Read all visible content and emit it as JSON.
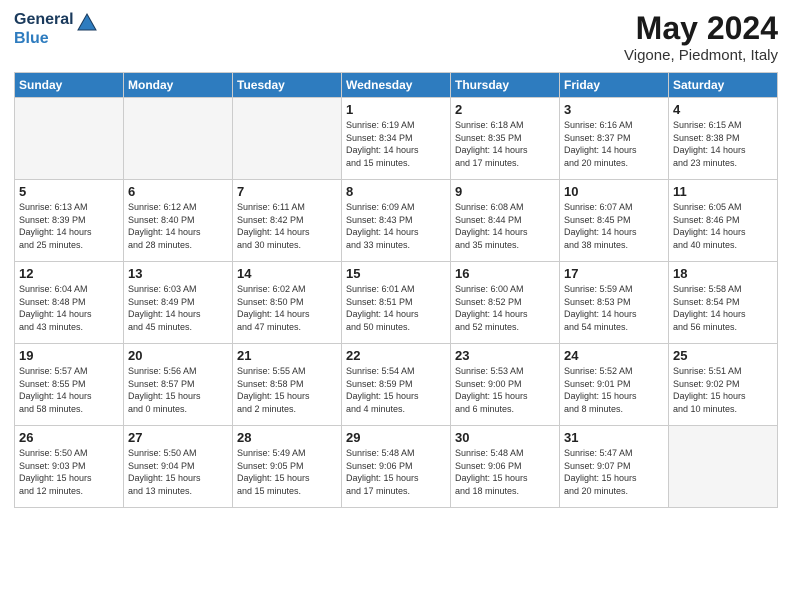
{
  "header": {
    "logo_line1": "General",
    "logo_line2": "Blue",
    "month": "May 2024",
    "location": "Vigone, Piedmont, Italy"
  },
  "weekdays": [
    "Sunday",
    "Monday",
    "Tuesday",
    "Wednesday",
    "Thursday",
    "Friday",
    "Saturday"
  ],
  "weeks": [
    [
      {
        "day": "",
        "info": "",
        "empty": true
      },
      {
        "day": "",
        "info": "",
        "empty": true
      },
      {
        "day": "",
        "info": "",
        "empty": true
      },
      {
        "day": "1",
        "info": "Sunrise: 6:19 AM\nSunset: 8:34 PM\nDaylight: 14 hours\nand 15 minutes."
      },
      {
        "day": "2",
        "info": "Sunrise: 6:18 AM\nSunset: 8:35 PM\nDaylight: 14 hours\nand 17 minutes."
      },
      {
        "day": "3",
        "info": "Sunrise: 6:16 AM\nSunset: 8:37 PM\nDaylight: 14 hours\nand 20 minutes."
      },
      {
        "day": "4",
        "info": "Sunrise: 6:15 AM\nSunset: 8:38 PM\nDaylight: 14 hours\nand 23 minutes."
      }
    ],
    [
      {
        "day": "5",
        "info": "Sunrise: 6:13 AM\nSunset: 8:39 PM\nDaylight: 14 hours\nand 25 minutes."
      },
      {
        "day": "6",
        "info": "Sunrise: 6:12 AM\nSunset: 8:40 PM\nDaylight: 14 hours\nand 28 minutes."
      },
      {
        "day": "7",
        "info": "Sunrise: 6:11 AM\nSunset: 8:42 PM\nDaylight: 14 hours\nand 30 minutes."
      },
      {
        "day": "8",
        "info": "Sunrise: 6:09 AM\nSunset: 8:43 PM\nDaylight: 14 hours\nand 33 minutes."
      },
      {
        "day": "9",
        "info": "Sunrise: 6:08 AM\nSunset: 8:44 PM\nDaylight: 14 hours\nand 35 minutes."
      },
      {
        "day": "10",
        "info": "Sunrise: 6:07 AM\nSunset: 8:45 PM\nDaylight: 14 hours\nand 38 minutes."
      },
      {
        "day": "11",
        "info": "Sunrise: 6:05 AM\nSunset: 8:46 PM\nDaylight: 14 hours\nand 40 minutes."
      }
    ],
    [
      {
        "day": "12",
        "info": "Sunrise: 6:04 AM\nSunset: 8:48 PM\nDaylight: 14 hours\nand 43 minutes."
      },
      {
        "day": "13",
        "info": "Sunrise: 6:03 AM\nSunset: 8:49 PM\nDaylight: 14 hours\nand 45 minutes."
      },
      {
        "day": "14",
        "info": "Sunrise: 6:02 AM\nSunset: 8:50 PM\nDaylight: 14 hours\nand 47 minutes."
      },
      {
        "day": "15",
        "info": "Sunrise: 6:01 AM\nSunset: 8:51 PM\nDaylight: 14 hours\nand 50 minutes."
      },
      {
        "day": "16",
        "info": "Sunrise: 6:00 AM\nSunset: 8:52 PM\nDaylight: 14 hours\nand 52 minutes."
      },
      {
        "day": "17",
        "info": "Sunrise: 5:59 AM\nSunset: 8:53 PM\nDaylight: 14 hours\nand 54 minutes."
      },
      {
        "day": "18",
        "info": "Sunrise: 5:58 AM\nSunset: 8:54 PM\nDaylight: 14 hours\nand 56 minutes."
      }
    ],
    [
      {
        "day": "19",
        "info": "Sunrise: 5:57 AM\nSunset: 8:55 PM\nDaylight: 14 hours\nand 58 minutes."
      },
      {
        "day": "20",
        "info": "Sunrise: 5:56 AM\nSunset: 8:57 PM\nDaylight: 15 hours\nand 0 minutes."
      },
      {
        "day": "21",
        "info": "Sunrise: 5:55 AM\nSunset: 8:58 PM\nDaylight: 15 hours\nand 2 minutes."
      },
      {
        "day": "22",
        "info": "Sunrise: 5:54 AM\nSunset: 8:59 PM\nDaylight: 15 hours\nand 4 minutes."
      },
      {
        "day": "23",
        "info": "Sunrise: 5:53 AM\nSunset: 9:00 PM\nDaylight: 15 hours\nand 6 minutes."
      },
      {
        "day": "24",
        "info": "Sunrise: 5:52 AM\nSunset: 9:01 PM\nDaylight: 15 hours\nand 8 minutes."
      },
      {
        "day": "25",
        "info": "Sunrise: 5:51 AM\nSunset: 9:02 PM\nDaylight: 15 hours\nand 10 minutes."
      }
    ],
    [
      {
        "day": "26",
        "info": "Sunrise: 5:50 AM\nSunset: 9:03 PM\nDaylight: 15 hours\nand 12 minutes."
      },
      {
        "day": "27",
        "info": "Sunrise: 5:50 AM\nSunset: 9:04 PM\nDaylight: 15 hours\nand 13 minutes."
      },
      {
        "day": "28",
        "info": "Sunrise: 5:49 AM\nSunset: 9:05 PM\nDaylight: 15 hours\nand 15 minutes."
      },
      {
        "day": "29",
        "info": "Sunrise: 5:48 AM\nSunset: 9:06 PM\nDaylight: 15 hours\nand 17 minutes."
      },
      {
        "day": "30",
        "info": "Sunrise: 5:48 AM\nSunset: 9:06 PM\nDaylight: 15 hours\nand 18 minutes."
      },
      {
        "day": "31",
        "info": "Sunrise: 5:47 AM\nSunset: 9:07 PM\nDaylight: 15 hours\nand 20 minutes."
      },
      {
        "day": "",
        "info": "",
        "empty": true
      }
    ]
  ]
}
